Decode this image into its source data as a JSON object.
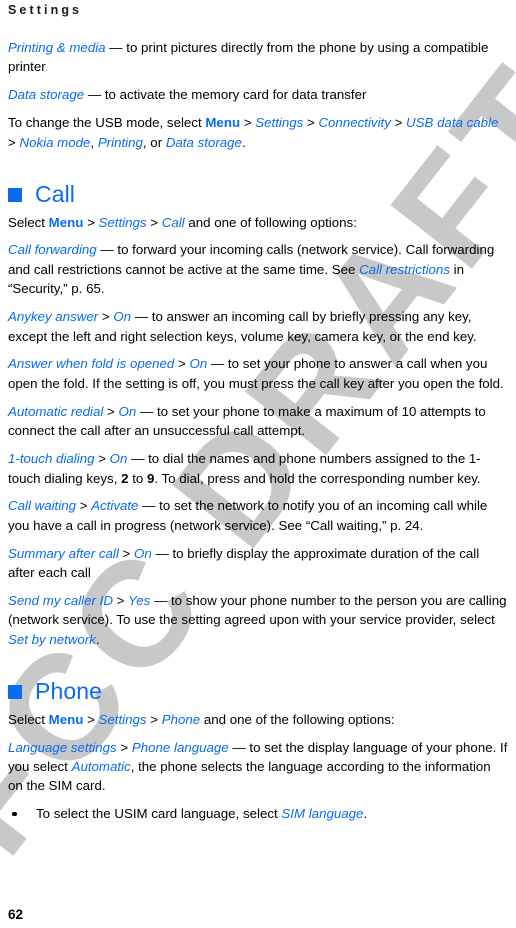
{
  "running_head": "Settings",
  "folio": "62",
  "watermark": {
    "text": "FCC DRAFT",
    "color": "#c8c8c8"
  },
  "colors": {
    "link_blue": "#0a6bef",
    "body_black": "#000000",
    "watermark_gray": "#c8c8c8"
  },
  "intro": {
    "printing": {
      "term": "Printing & media",
      "dash": " — ",
      "text": "to print pictures directly from the phone by using a compatible printer"
    },
    "data_storage": {
      "term": "Data storage",
      "dash": " — ",
      "text": "to activate the memory card for data transfer"
    },
    "usb_mode": {
      "lead": "To change the USB mode, select ",
      "menu": "Menu",
      "gt1": " > ",
      "settings": "Settings",
      "gt2": " > ",
      "connectivity": "Connectivity",
      "gt3": " > ",
      "usb_data_cable": "USB data cable",
      "gt4": " > ",
      "nokia_mode": "Nokia mode",
      "comma1": ", ",
      "printing": "Printing",
      "comma2": ", or ",
      "data_storage": "Data storage",
      "period": "."
    }
  },
  "call_section": {
    "heading": "Call",
    "intro": {
      "lead": "Select ",
      "menu": "Menu",
      "gt1": " > ",
      "settings": "Settings",
      "gt2": " > ",
      "call": "Call",
      "tail": " and one of following options:"
    },
    "options": [
      {
        "term": "Call forwarding",
        "dash": " — ",
        "text_a": "to forward your incoming calls (network service). Call forwarding and call restrictions cannot be active at the same time. See ",
        "ref": "Call restrictions",
        "text_b": " in “Security,” p. 65."
      },
      {
        "term": "Anykey answer",
        "gt": " > ",
        "value": "On",
        "dash": " — ",
        "text_a": "to answer an incoming call by briefly pressing any key, except the left and right selection keys, volume key, camera key, or the end key."
      },
      {
        "term": "Answer when fold is opened",
        "gt": " > ",
        "value": "On",
        "dash": " — ",
        "text_a": "to set your phone to answer a call when you open the fold. If the setting is off, you must press the call key after you open the fold."
      },
      {
        "term": "Automatic redial",
        "gt": " > ",
        "value": "On",
        "dash": " — ",
        "text_a": "to set your phone to make a maximum of 10 attempts to connect the call after an unsuccessful call attempt."
      },
      {
        "term": "1-touch dialing",
        "gt": " > ",
        "value": "On",
        "dash": " — ",
        "text_a": "to dial the names and phone numbers assigned to the 1-touch dialing keys, ",
        "key_low": "2",
        "text_mid": " to ",
        "key_high": "9",
        "text_b": ". To dial, press and hold the corresponding number key."
      },
      {
        "term": "Call waiting",
        "gt": " > ",
        "value": "Activate",
        "dash": " — ",
        "text_a": "to set the network to notify you of an incoming call while you have a call in progress (network service). See “Call waiting,” p. 24."
      },
      {
        "term": "Summary after call",
        "gt": " > ",
        "value": "On",
        "dash": " — ",
        "text_a": "to briefly display the approximate duration of the call after each call"
      },
      {
        "term": "Send my caller ID",
        "gt": " > ",
        "value": "Yes",
        "dash": " — ",
        "text_a": "to show your phone number to the person you are calling (network service). To use the setting agreed upon with your service provider, select ",
        "ref": "Set by network",
        "text_b": "."
      }
    ]
  },
  "phone_section": {
    "heading": "Phone",
    "intro": {
      "lead": "Select ",
      "menu": "Menu",
      "gt1": " > ",
      "settings": "Settings",
      "gt2": " > ",
      "phone": "Phone",
      "tail": " and one of the following options:"
    },
    "language_settings": {
      "term": "Language settings",
      "gt": " > ",
      "value": "Phone language",
      "dash": " — ",
      "text_a": "to set the display language of your phone. If you select ",
      "ref": "Automatic",
      "text_b": ", the phone selects the language according to the information on the SIM card."
    },
    "bullets": [
      {
        "text_a": "To select the USIM card language, select ",
        "ref": "SIM language",
        "text_b": "."
      }
    ]
  }
}
